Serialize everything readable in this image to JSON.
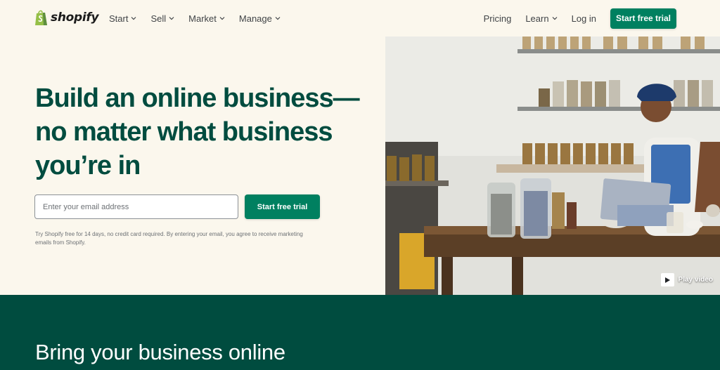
{
  "brand": {
    "name": "shopify",
    "color": "#95bf47"
  },
  "nav": {
    "left": [
      {
        "label": "Start",
        "dropdown": true
      },
      {
        "label": "Sell",
        "dropdown": true
      },
      {
        "label": "Market",
        "dropdown": true
      },
      {
        "label": "Manage",
        "dropdown": true
      }
    ],
    "pricing": "Pricing",
    "learn": "Learn",
    "login": "Log in",
    "cta": "Start free trial"
  },
  "hero": {
    "title": "Build an online business—no matter what business you’re in",
    "email_placeholder": "Enter your email address",
    "cta": "Start free trial",
    "disclaimer": "Try Shopify free for 14 days, no credit card required. By entering your email, you agree to receive marketing emails from Shopify."
  },
  "media": {
    "play_label": "Play video"
  },
  "section": {
    "title": "Bring your business online"
  },
  "colors": {
    "accent": "#008060",
    "dark_green": "#004c3f",
    "background": "#fbf7ed"
  }
}
